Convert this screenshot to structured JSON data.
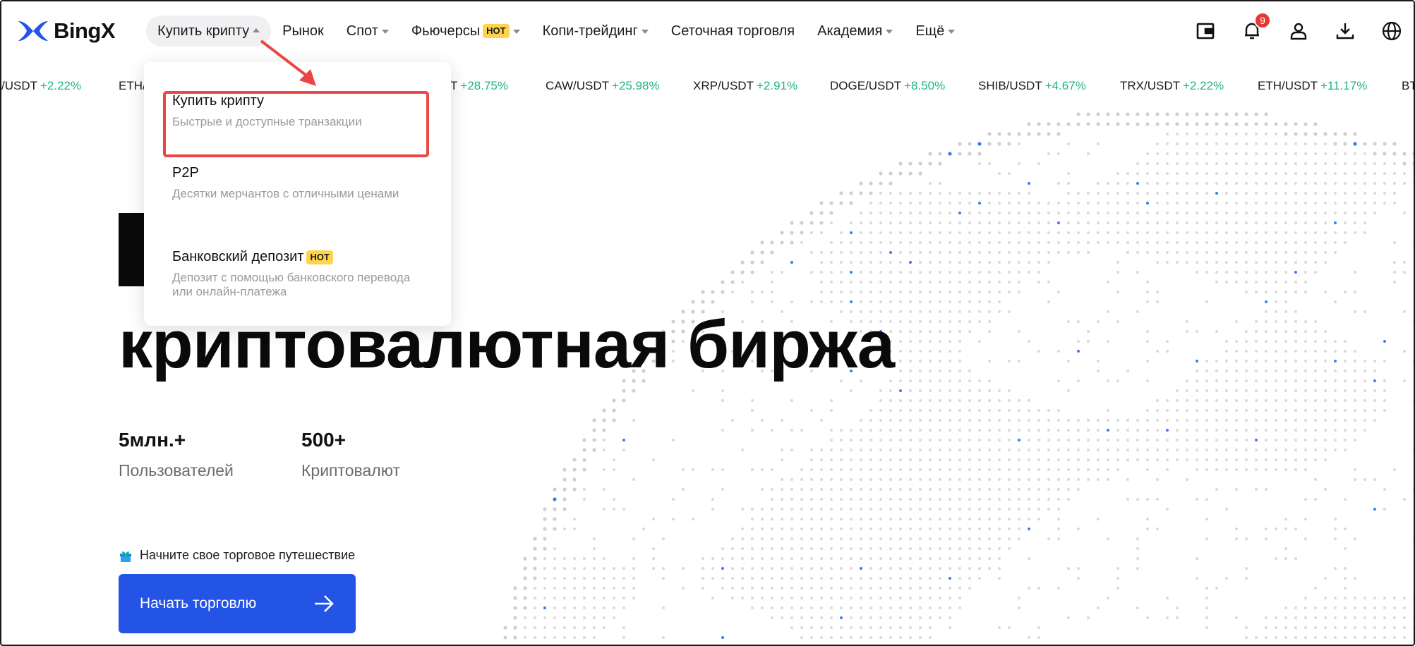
{
  "brand": {
    "name": "BingX",
    "accent": "#2354e6"
  },
  "nav": {
    "items": [
      {
        "label": "Купить крипту",
        "caret": "up",
        "active": true
      },
      {
        "label": "Рынок"
      },
      {
        "label": "Спот",
        "caret": "down"
      },
      {
        "label": "Фьючерсы",
        "badge": "HOT",
        "caret": "down"
      },
      {
        "label": "Копи-трейдинг",
        "caret": "down"
      },
      {
        "label": "Сеточная торговля"
      },
      {
        "label": "Академия",
        "caret": "down"
      },
      {
        "label": "Ещё",
        "caret": "down"
      }
    ],
    "icons": [
      "wallet-icon",
      "bell-icon",
      "user-icon",
      "download-icon",
      "globe-icon"
    ],
    "notification_count": "9"
  },
  "ticker": [
    {
      "pair": "/USDT",
      "change": "+2.22%"
    },
    {
      "pair": "ETH/",
      "change": ""
    },
    {
      "pair": "T",
      "change": "+28.75%"
    },
    {
      "pair": "CAW/USDT",
      "change": "+25.98%"
    },
    {
      "pair": "XRP/USDT",
      "change": "+2.91%"
    },
    {
      "pair": "DOGE/USDT",
      "change": "+8.50%"
    },
    {
      "pair": "SHIB/USDT",
      "change": "+4.67%"
    },
    {
      "pair": "TRX/USDT",
      "change": "+2.22%"
    },
    {
      "pair": "ETH/USDT",
      "change": "+11.17%"
    },
    {
      "pair": "BT",
      "change": ""
    }
  ],
  "dropdown": {
    "items": [
      {
        "title": "Купить крипту",
        "desc": "Быстрые и доступные транзакции"
      },
      {
        "title": "P2P",
        "desc": "Десятки мерчантов с отличными ценами"
      },
      {
        "title": "Банковский депозит",
        "badge": "HOT",
        "desc": "Депозит с помощью банковского перевода или онлайн-платежа"
      }
    ]
  },
  "hero": {
    "title": "криптовалютная биржа",
    "stats": [
      {
        "value": "5млн.+",
        "label": "Пользователей"
      },
      {
        "value": "500+",
        "label": "Криптовалют"
      }
    ],
    "journey_text": "Начните свое торговое путешествие",
    "cta_label": "Начать торговлю"
  },
  "colors": {
    "positive": "#1fb386",
    "hot_badge": "#ffd34d",
    "highlight": "#ea4744"
  }
}
